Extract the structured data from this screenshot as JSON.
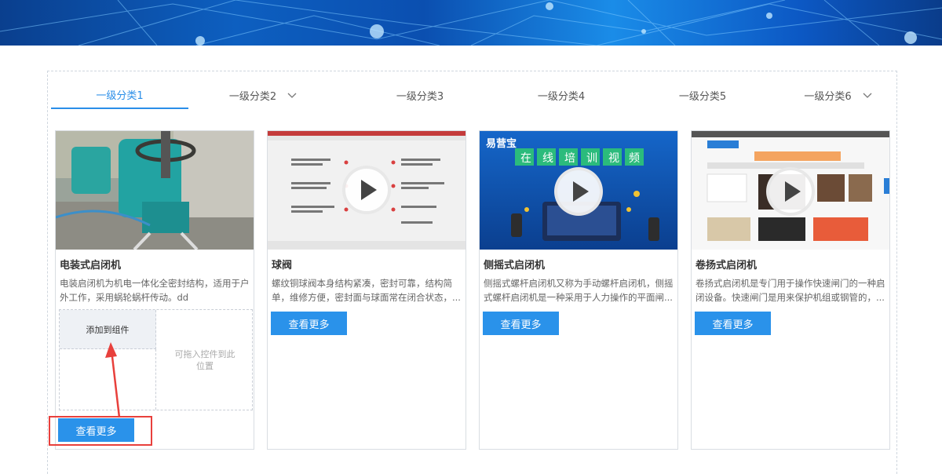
{
  "tabs": [
    {
      "label": "一级分类1",
      "active": true,
      "has_dropdown": false
    },
    {
      "label": "一级分类2",
      "active": false,
      "has_dropdown": true
    },
    {
      "label": "一级分类3",
      "active": false,
      "has_dropdown": false
    },
    {
      "label": "一级分类4",
      "active": false,
      "has_dropdown": false
    },
    {
      "label": "一级分类5",
      "active": false,
      "has_dropdown": false
    },
    {
      "label": "一级分类6",
      "active": false,
      "has_dropdown": true
    }
  ],
  "cards": [
    {
      "title": "电装式启闭机",
      "desc": "电装启闭机为机电一体化全密封结构，适用于户外工作，采用蜗轮蜗杆传动。dd",
      "button": "查看更多",
      "has_video": false
    },
    {
      "title": "球阀",
      "desc": "螺纹铜球阀本身结构紧凑，密封可靠，结构简单，维修方便，密封面与球面常在闭合状态，...",
      "button": "查看更多",
      "has_video": true
    },
    {
      "title": "侧摇式启闭机",
      "desc": "侧摇式螺杆启闭机又称为手动螺杆启闭机，侧摇式螺杆启闭机是一种采用于人力操作的平面闸...",
      "button": "查看更多",
      "has_video": true
    },
    {
      "title": "卷扬式启闭机",
      "desc": "卷扬式启闭机是专门用于操作快速闸门的一种启闭设备。快速闸门是用来保护机组或钢管的，...",
      "button": "查看更多",
      "has_video": true
    }
  ],
  "dropzone": {
    "add_label": "添加到组件",
    "hint": "可拖入控件到此位置"
  },
  "thumb3": {
    "brand": "易营宝",
    "banner_chars": [
      "在",
      "线",
      "培",
      "训",
      "视",
      "频"
    ]
  },
  "colors": {
    "accent": "#2a8ee8",
    "button": "#2a92ea",
    "annotation": "#e8403c"
  }
}
